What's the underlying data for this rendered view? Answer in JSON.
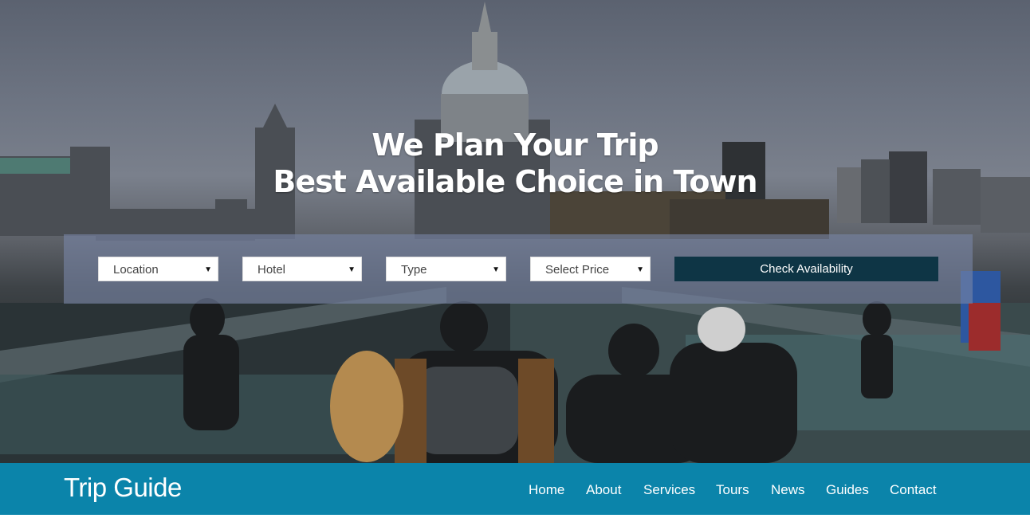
{
  "hero": {
    "line1": "We Plan Your Trip",
    "line2": "Best Available Choice in Town"
  },
  "search": {
    "location": "Location",
    "hotel": "Hotel",
    "type": "Type",
    "price": "Select Price",
    "submit": "Check Availability"
  },
  "nav": {
    "brand": "Trip Guide",
    "items": [
      "Home",
      "About",
      "Services",
      "Tours",
      "News",
      "Guides",
      "Contact"
    ]
  },
  "colors": {
    "navbar": "#0b84aa",
    "button": "#0e3545",
    "panel": "rgba(120,132,165,0.62)"
  },
  "icons": {
    "caret": "caret-down-icon"
  }
}
